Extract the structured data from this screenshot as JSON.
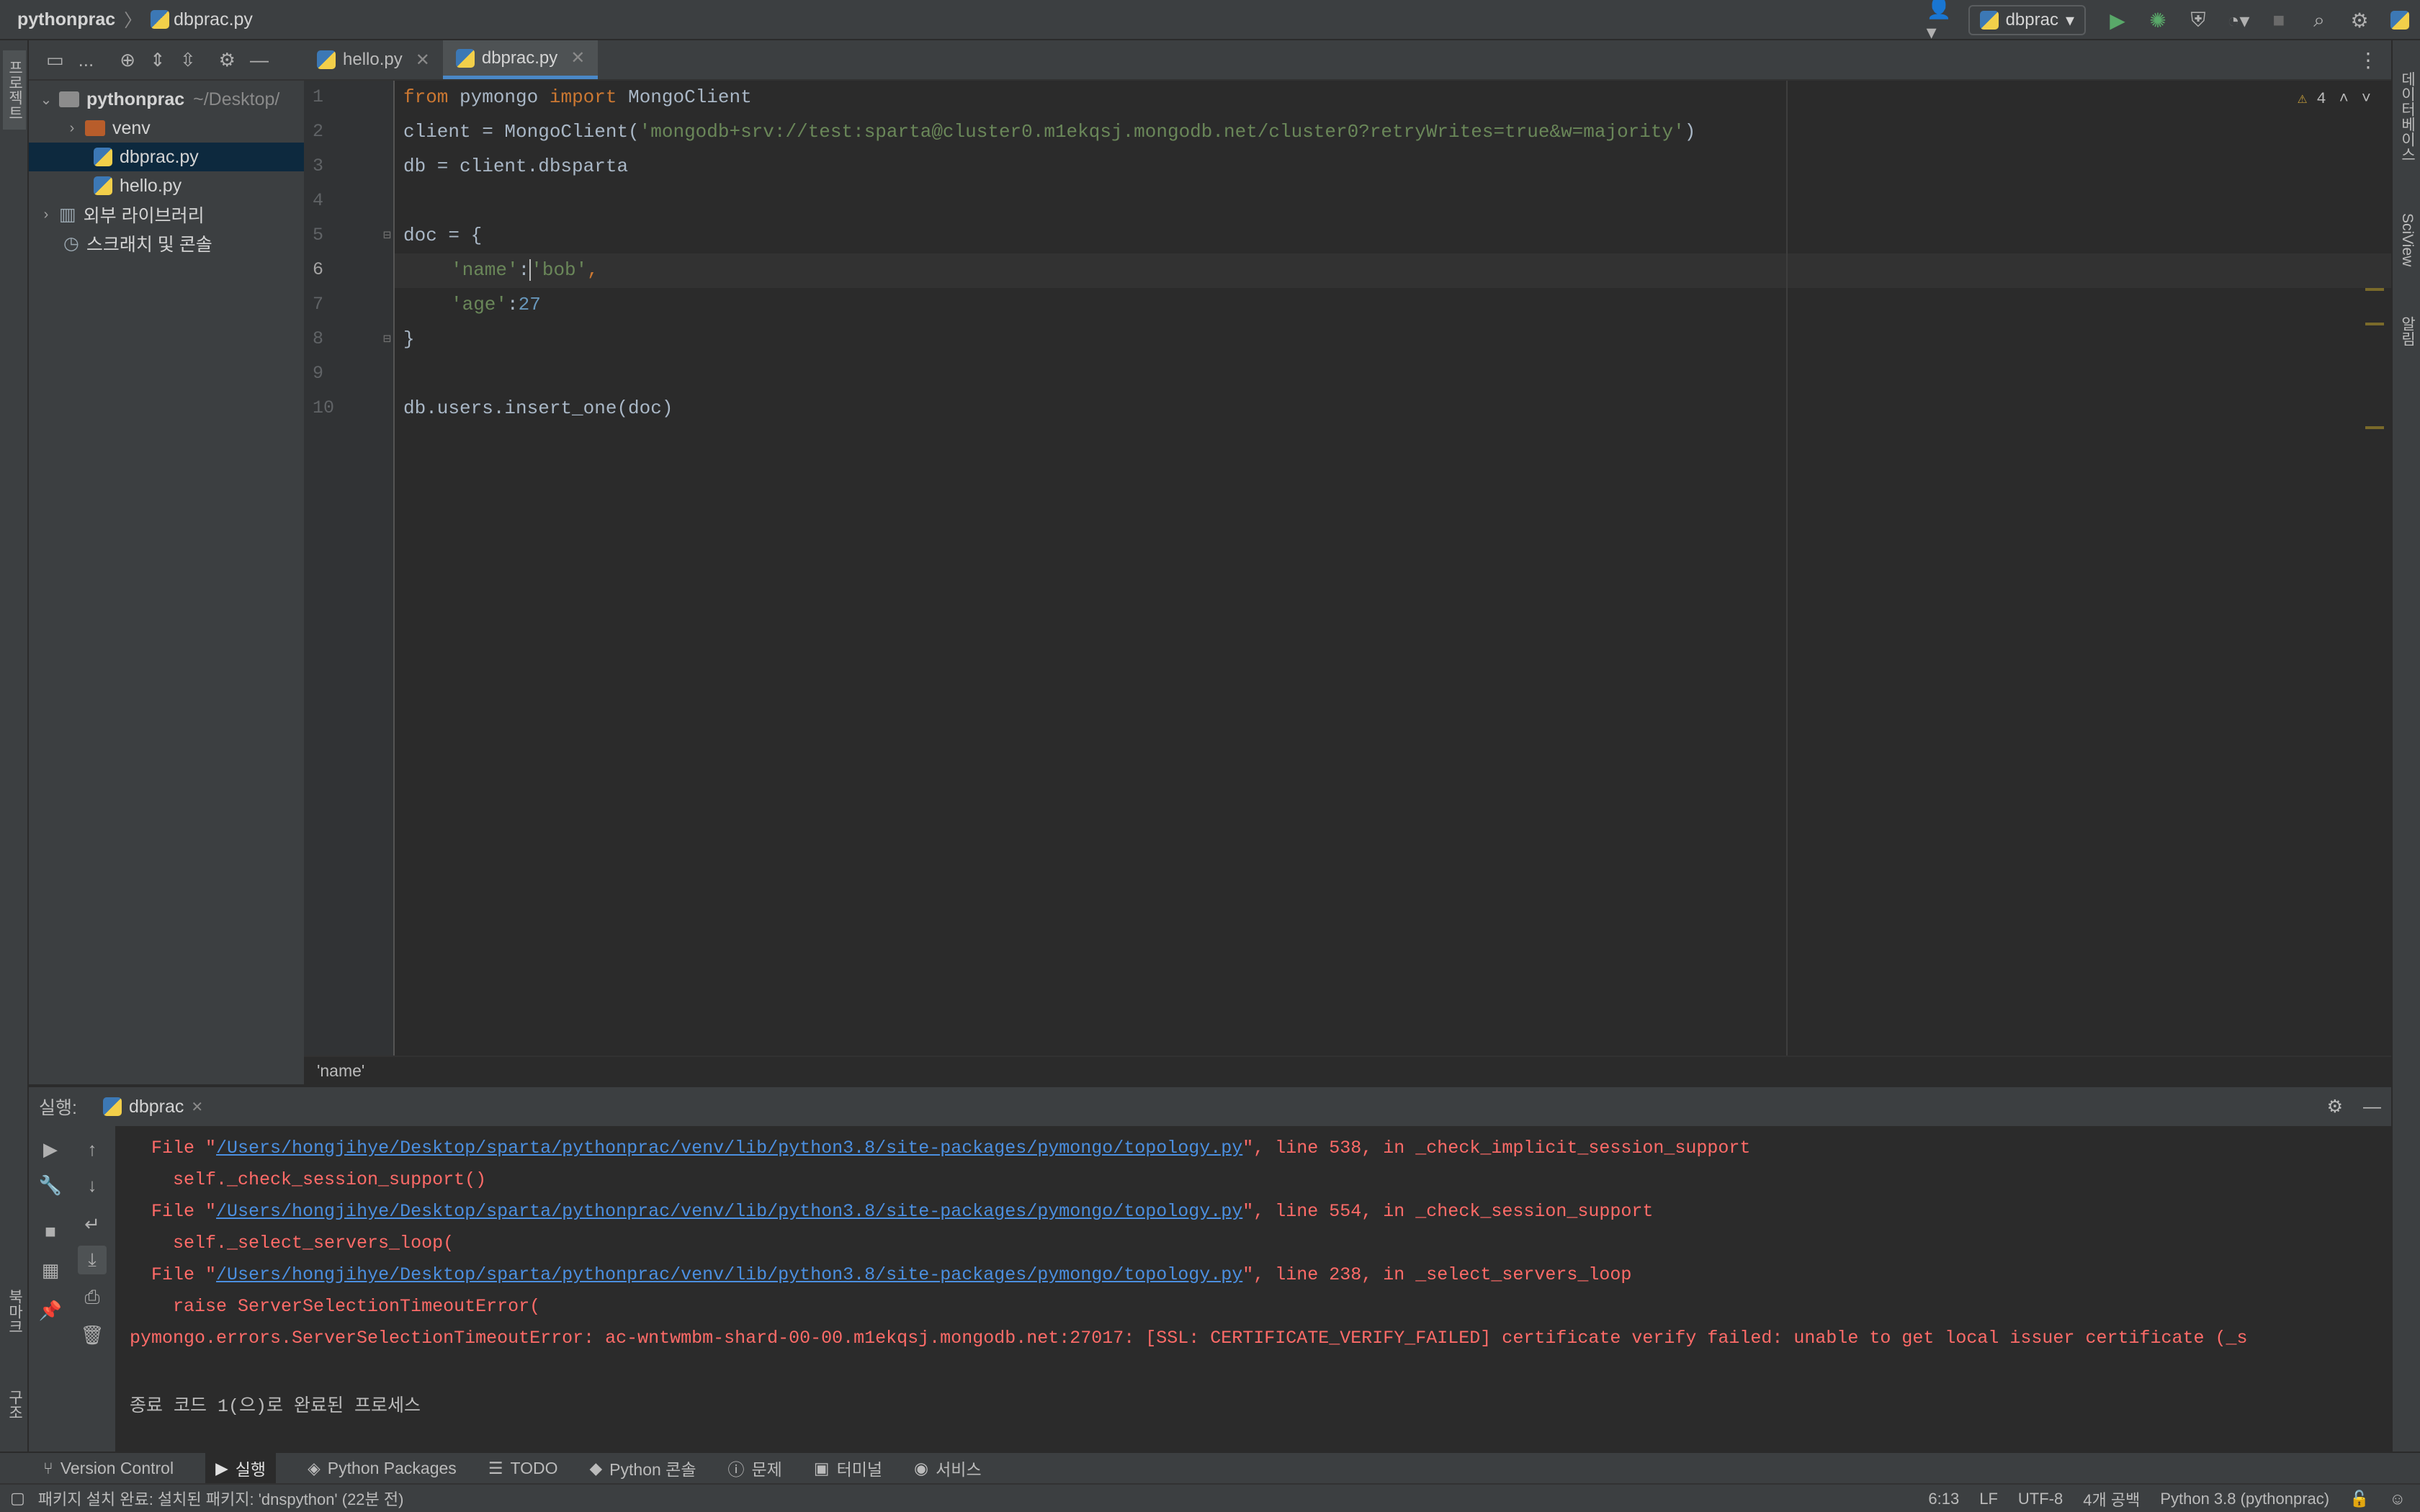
{
  "titlebar": {
    "project": "pythonprac",
    "separator": "〉",
    "file": "dbprac.py",
    "run_config": "dbprac"
  },
  "left_strip": {
    "project_label": "프로젝트",
    "bookmarks_label": "북마크",
    "structure_label": "구조"
  },
  "right_strip": {
    "database_label": "데이터베이스",
    "sciview_label": "SciView",
    "notifications_label": "알림"
  },
  "project_tree": {
    "toolbar_menu": "...",
    "root_name": "pythonprac",
    "root_path": "~/Desktop/",
    "items": [
      {
        "label": "venv"
      },
      {
        "label": "dbprac.py"
      },
      {
        "label": "hello.py"
      },
      {
        "label": "외부 라이브러리"
      },
      {
        "label": "스크래치 및 콘솔"
      }
    ]
  },
  "tabs": [
    {
      "label": "hello.py",
      "close": "✕"
    },
    {
      "label": "dbprac.py",
      "close": "✕"
    }
  ],
  "editor": {
    "line_numbers": [
      "1",
      "2",
      "3",
      "4",
      "5",
      "6",
      "7",
      "8",
      "9",
      "10"
    ],
    "inspection_count": "4",
    "lines": {
      "l1_kw1": "from",
      "l1_mod": " pymongo ",
      "l1_kw2": "import",
      "l1_name": " MongoClient",
      "l2_pre": "client = MongoClient(",
      "l2_str": "'mongodb+srv://test:sparta@cluster0.m1ekqsj.mongodb.net/cluster0?retryWrites=true&w=majority'",
      "l2_post": ")",
      "l3": "db = client.dbsparta",
      "l5": "doc = {",
      "l6_key": "'name'",
      "l6_colon": ":",
      "l6_val": "'bob'",
      "l6_comma": ",",
      "l7_key": "'age'",
      "l7_colon": ":",
      "l7_val": "27",
      "l8": "}",
      "l10": "db.users.insert_one(doc)"
    },
    "breadcrumb": "'name'"
  },
  "run": {
    "label": "실행:",
    "config": "dbprac",
    "close": "✕",
    "console": {
      "c1_pre": "  File \"",
      "c1_link": "/Users/hongjihye/Desktop/sparta/pythonprac/venv/lib/python3.8/site-packages/pymongo/topology.py",
      "c1_post": "\", line 538, in _check_implicit_session_support",
      "c2": "    self._check_session_support()",
      "c3_pre": "  File \"",
      "c3_link": "/Users/hongjihye/Desktop/sparta/pythonprac/venv/lib/python3.8/site-packages/pymongo/topology.py",
      "c3_post": "\", line 554, in _check_session_support",
      "c4": "    self._select_servers_loop(",
      "c5_pre": "  File \"",
      "c5_link": "/Users/hongjihye/Desktop/sparta/pythonprac/venv/lib/python3.8/site-packages/pymongo/topology.py",
      "c5_post": "\", line 238, in _select_servers_loop",
      "c6": "    raise ServerSelectionTimeoutError(",
      "c7": "pymongo.errors.ServerSelectionTimeoutError: ac-wntwmbm-shard-00-00.m1ekqsj.mongodb.net:27017: [SSL: CERTIFICATE_VERIFY_FAILED] certificate verify failed: unable to get local issuer certificate (_s",
      "c9": "종료 코드 1(으)로 완료된 프로세스"
    }
  },
  "tool_windows": [
    {
      "label": "Version Control"
    },
    {
      "label": "실행"
    },
    {
      "label": "Python Packages"
    },
    {
      "label": "TODO"
    },
    {
      "label": "Python 콘솔"
    },
    {
      "label": "문제"
    },
    {
      "label": "터미널"
    },
    {
      "label": "서비스"
    }
  ],
  "statusbar": {
    "message": "패키지 설치 완료: 설치된 패키지: 'dnspython' (22분 전)",
    "position": "6:13",
    "line_sep": "LF",
    "encoding": "UTF-8",
    "indent": "4개 공백",
    "interpreter": "Python 3.8 (pythonprac)"
  },
  "colors": {
    "accent": "#4a88c7",
    "keyword": "#cc7832",
    "string": "#6a8759",
    "number": "#6897bb",
    "error": "#ff6b68",
    "link": "#4b8fe0",
    "run_green": "#59a869"
  }
}
